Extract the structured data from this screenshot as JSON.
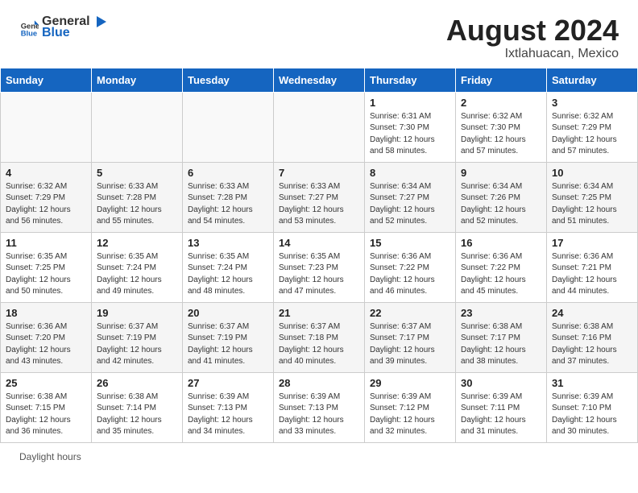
{
  "header": {
    "logo_general": "General",
    "logo_blue": "Blue",
    "title": "August 2024",
    "location": "Ixtlahuacan, Mexico"
  },
  "columns": [
    "Sunday",
    "Monday",
    "Tuesday",
    "Wednesday",
    "Thursday",
    "Friday",
    "Saturday"
  ],
  "weeks": [
    [
      {
        "day": "",
        "info": ""
      },
      {
        "day": "",
        "info": ""
      },
      {
        "day": "",
        "info": ""
      },
      {
        "day": "",
        "info": ""
      },
      {
        "day": "1",
        "info": "Sunrise: 6:31 AM\nSunset: 7:30 PM\nDaylight: 12 hours and 58 minutes."
      },
      {
        "day": "2",
        "info": "Sunrise: 6:32 AM\nSunset: 7:30 PM\nDaylight: 12 hours and 57 minutes."
      },
      {
        "day": "3",
        "info": "Sunrise: 6:32 AM\nSunset: 7:29 PM\nDaylight: 12 hours and 57 minutes."
      }
    ],
    [
      {
        "day": "4",
        "info": "Sunrise: 6:32 AM\nSunset: 7:29 PM\nDaylight: 12 hours and 56 minutes."
      },
      {
        "day": "5",
        "info": "Sunrise: 6:33 AM\nSunset: 7:28 PM\nDaylight: 12 hours and 55 minutes."
      },
      {
        "day": "6",
        "info": "Sunrise: 6:33 AM\nSunset: 7:28 PM\nDaylight: 12 hours and 54 minutes."
      },
      {
        "day": "7",
        "info": "Sunrise: 6:33 AM\nSunset: 7:27 PM\nDaylight: 12 hours and 53 minutes."
      },
      {
        "day": "8",
        "info": "Sunrise: 6:34 AM\nSunset: 7:27 PM\nDaylight: 12 hours and 52 minutes."
      },
      {
        "day": "9",
        "info": "Sunrise: 6:34 AM\nSunset: 7:26 PM\nDaylight: 12 hours and 52 minutes."
      },
      {
        "day": "10",
        "info": "Sunrise: 6:34 AM\nSunset: 7:25 PM\nDaylight: 12 hours and 51 minutes."
      }
    ],
    [
      {
        "day": "11",
        "info": "Sunrise: 6:35 AM\nSunset: 7:25 PM\nDaylight: 12 hours and 50 minutes."
      },
      {
        "day": "12",
        "info": "Sunrise: 6:35 AM\nSunset: 7:24 PM\nDaylight: 12 hours and 49 minutes."
      },
      {
        "day": "13",
        "info": "Sunrise: 6:35 AM\nSunset: 7:24 PM\nDaylight: 12 hours and 48 minutes."
      },
      {
        "day": "14",
        "info": "Sunrise: 6:35 AM\nSunset: 7:23 PM\nDaylight: 12 hours and 47 minutes."
      },
      {
        "day": "15",
        "info": "Sunrise: 6:36 AM\nSunset: 7:22 PM\nDaylight: 12 hours and 46 minutes."
      },
      {
        "day": "16",
        "info": "Sunrise: 6:36 AM\nSunset: 7:22 PM\nDaylight: 12 hours and 45 minutes."
      },
      {
        "day": "17",
        "info": "Sunrise: 6:36 AM\nSunset: 7:21 PM\nDaylight: 12 hours and 44 minutes."
      }
    ],
    [
      {
        "day": "18",
        "info": "Sunrise: 6:36 AM\nSunset: 7:20 PM\nDaylight: 12 hours and 43 minutes."
      },
      {
        "day": "19",
        "info": "Sunrise: 6:37 AM\nSunset: 7:19 PM\nDaylight: 12 hours and 42 minutes."
      },
      {
        "day": "20",
        "info": "Sunrise: 6:37 AM\nSunset: 7:19 PM\nDaylight: 12 hours and 41 minutes."
      },
      {
        "day": "21",
        "info": "Sunrise: 6:37 AM\nSunset: 7:18 PM\nDaylight: 12 hours and 40 minutes."
      },
      {
        "day": "22",
        "info": "Sunrise: 6:37 AM\nSunset: 7:17 PM\nDaylight: 12 hours and 39 minutes."
      },
      {
        "day": "23",
        "info": "Sunrise: 6:38 AM\nSunset: 7:17 PM\nDaylight: 12 hours and 38 minutes."
      },
      {
        "day": "24",
        "info": "Sunrise: 6:38 AM\nSunset: 7:16 PM\nDaylight: 12 hours and 37 minutes."
      }
    ],
    [
      {
        "day": "25",
        "info": "Sunrise: 6:38 AM\nSunset: 7:15 PM\nDaylight: 12 hours and 36 minutes."
      },
      {
        "day": "26",
        "info": "Sunrise: 6:38 AM\nSunset: 7:14 PM\nDaylight: 12 hours and 35 minutes."
      },
      {
        "day": "27",
        "info": "Sunrise: 6:39 AM\nSunset: 7:13 PM\nDaylight: 12 hours and 34 minutes."
      },
      {
        "day": "28",
        "info": "Sunrise: 6:39 AM\nSunset: 7:13 PM\nDaylight: 12 hours and 33 minutes."
      },
      {
        "day": "29",
        "info": "Sunrise: 6:39 AM\nSunset: 7:12 PM\nDaylight: 12 hours and 32 minutes."
      },
      {
        "day": "30",
        "info": "Sunrise: 6:39 AM\nSunset: 7:11 PM\nDaylight: 12 hours and 31 minutes."
      },
      {
        "day": "31",
        "info": "Sunrise: 6:39 AM\nSunset: 7:10 PM\nDaylight: 12 hours and 30 minutes."
      }
    ]
  ],
  "footer": {
    "daylight_label": "Daylight hours"
  }
}
